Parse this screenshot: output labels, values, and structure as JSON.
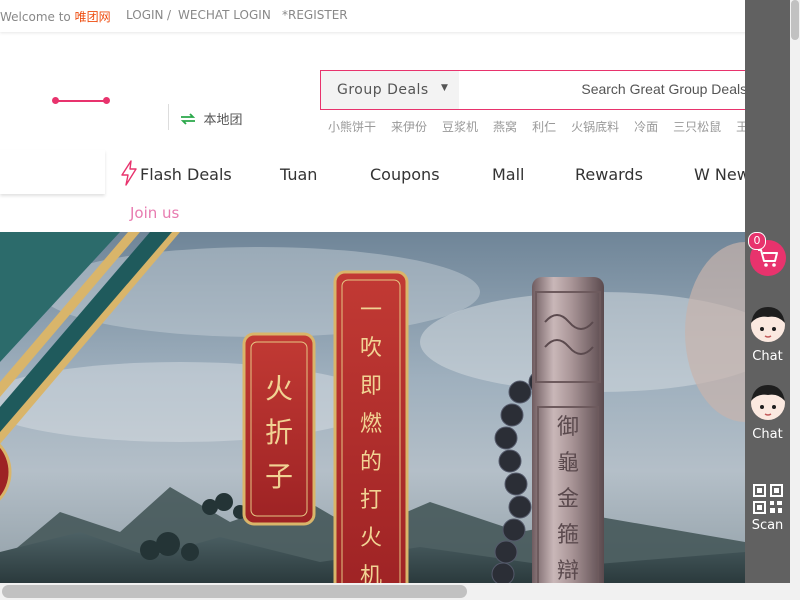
{
  "topbar": {
    "welcome_prefix": "Welcome to ",
    "brand": "唯团网",
    "login": "LOGIN",
    "separator": "/",
    "wechat_login": "WECHAT LOGIN",
    "register": "*REGISTER"
  },
  "location": {
    "label": "本地团"
  },
  "search": {
    "deal_type": "Group Deals",
    "placeholder": "Search Great Group Deals!",
    "value": ""
  },
  "hot_words": [
    "小熊饼干",
    "来伊份",
    "豆浆机",
    "燕窝",
    "利仁",
    "火锅底料",
    "冷面",
    "三只松鼠",
    "王"
  ],
  "nav": {
    "items": [
      "Flash Deals",
      "Tuan",
      "Coupons",
      "Mall",
      "Rewards",
      "W New"
    ],
    "join": "Join us"
  },
  "banner": {
    "tag_short": [
      "火",
      "折",
      "子"
    ],
    "tag_long": [
      "一",
      "吹",
      "即",
      "燃",
      "的",
      "打",
      "火",
      "机"
    ],
    "engraving": [
      "御",
      "龜",
      "金",
      "箍",
      "辯"
    ]
  },
  "sidebar": {
    "cart_count": "0",
    "chat_1": "Chat",
    "chat_2": "Chat",
    "scan": "Scan"
  },
  "colors": {
    "accent": "#e8336d",
    "brand_orange": "#ee4d10",
    "join_pink": "#e87bb0",
    "sidebar_bg": "#616161",
    "banner_tag_red": "#b42a2a",
    "banner_gold": "#d9b56a"
  }
}
